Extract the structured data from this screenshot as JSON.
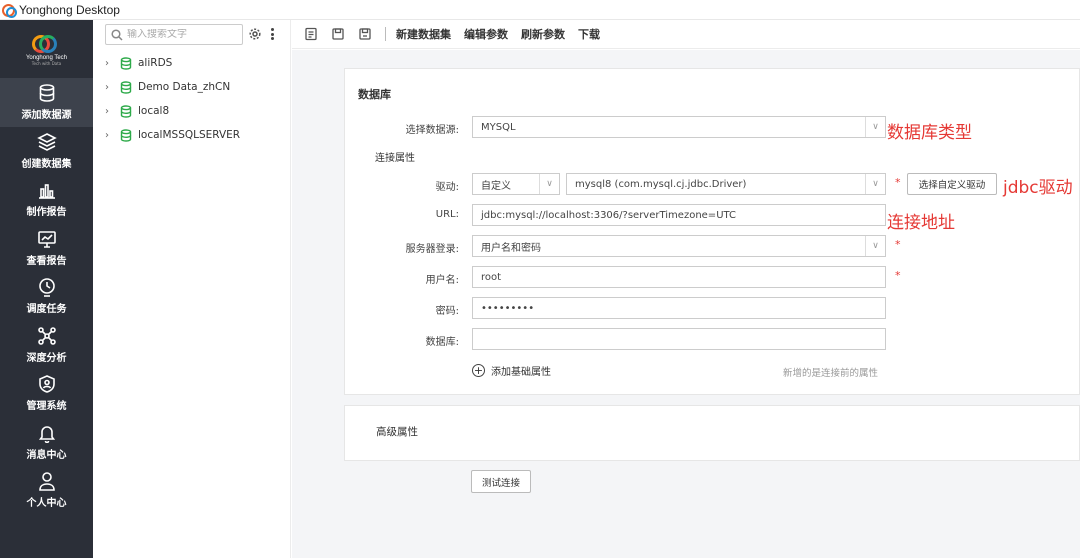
{
  "window": {
    "title": "Yonghong Desktop"
  },
  "brand": {
    "name": "Yonghong Tech",
    "tagline": "Tech with Data"
  },
  "nav": [
    {
      "label": "添加数据源",
      "icon": "database-icon",
      "active": true
    },
    {
      "label": "创建数据集",
      "icon": "layers-icon",
      "active": false
    },
    {
      "label": "制作报告",
      "icon": "bar-chart-icon",
      "active": false
    },
    {
      "label": "查看报告",
      "icon": "monitor-chart-icon",
      "active": false
    },
    {
      "label": "调度任务",
      "icon": "clock-upload-icon",
      "active": false
    },
    {
      "label": "深度分析",
      "icon": "network-icon",
      "active": false
    },
    {
      "label": "管理系统",
      "icon": "shield-user-icon",
      "active": false
    },
    {
      "label": "消息中心",
      "icon": "bell-icon",
      "active": false
    },
    {
      "label": "个人中心",
      "icon": "user-icon",
      "active": false
    }
  ],
  "tree": {
    "search_placeholder": "输入搜索文字",
    "items": [
      "aliRDS",
      "Demo Data_zhCN",
      "local8",
      "localMSSQLSERVER"
    ]
  },
  "toolbar": {
    "new_dataset": "新建数据集",
    "edit_params": "编辑参数",
    "refresh_params": "刷新参数",
    "download": "下载"
  },
  "form": {
    "section_db": "数据库",
    "datasource_label": "选择数据源:",
    "datasource_value": "MYSQL",
    "conn_props": "连接属性",
    "driver_label": "驱动:",
    "driver_mode": "自定义",
    "driver_value": "mysql8 (com.mysql.cj.jdbc.Driver)",
    "driver_button": "选择自定义驱动",
    "url_label": "URL:",
    "url_value": "jdbc:mysql://localhost:3306/?serverTimezone=UTC",
    "server_login_label": "服务器登录:",
    "server_login_value": "用户名和密码",
    "username_label": "用户名:",
    "username_value": "root",
    "password_label": "密码:",
    "password_value": "•••••••••",
    "database_label": "数据库:",
    "database_value": "",
    "add_basic_prop": "添加基础属性",
    "hint": "新增的是连接前的属性",
    "advanced": "高级属性",
    "test_button": "测试连接",
    "required_mark": "*"
  },
  "annotations": {
    "db_type": "数据库类型",
    "jdbc_driver": "jdbc驱动",
    "conn_url": "连接地址"
  },
  "colors": {
    "nav_bg": "#2b2f38",
    "nav_active": "#3d424c",
    "db_icon": "#2eaa4a",
    "annotation": "#e53935",
    "main_bg": "#f4f5f7"
  }
}
